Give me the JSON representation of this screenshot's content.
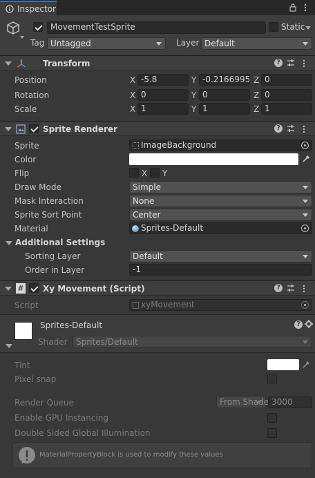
{
  "window": {
    "tab_label": "Inspector"
  },
  "gameobject": {
    "active": true,
    "name": "MovementTestSprite",
    "static_label": "Static",
    "tag_label": "Tag",
    "tag_value": "Untagged",
    "layer_label": "Layer",
    "layer_value": "Default"
  },
  "transform": {
    "title": "Transform",
    "position_label": "Position",
    "rotation_label": "Rotation",
    "scale_label": "Scale",
    "axis_x": "X",
    "axis_y": "Y",
    "axis_z": "Z",
    "position": {
      "x": "-5.8",
      "y": "-0.2166995",
      "z": "0"
    },
    "rotation": {
      "x": "0",
      "y": "0",
      "z": "0"
    },
    "scale": {
      "x": "1",
      "y": "1",
      "z": "1"
    }
  },
  "sprite_renderer": {
    "title": "Sprite Renderer",
    "enabled": true,
    "sprite_label": "Sprite",
    "sprite_value": "ImageBackground",
    "color_label": "Color",
    "color_value": "#ffffff",
    "flip_label": "Flip",
    "flip_x": "X",
    "flip_y": "Y",
    "draw_mode_label": "Draw Mode",
    "draw_mode_value": "Simple",
    "mask_label": "Mask Interaction",
    "mask_value": "None",
    "sort_point_label": "Sprite Sort Point",
    "sort_point_value": "Center",
    "material_label": "Material",
    "material_value": "Sprites-Default",
    "additional_label": "Additional Settings",
    "sorting_layer_label": "Sorting Layer",
    "sorting_layer_value": "Default",
    "order_label": "Order in Layer",
    "order_value": "-1"
  },
  "xy_movement": {
    "title": "Xy Movement (Script)",
    "enabled": true,
    "script_label": "Script",
    "script_value": "xyMovement"
  },
  "material": {
    "name": "Sprites-Default",
    "shader_label": "Shader",
    "shader_value": "Sprites/Default",
    "tint_label": "Tint",
    "tint_value": "#ffffff",
    "pixel_snap_label": "Pixel snap",
    "render_queue_label": "Render Queue",
    "render_queue_mode": "From Shader",
    "render_queue_value": "3000",
    "gpu_instancing_label": "Enable GPU Instancing",
    "double_sided_label": "Double Sided Global Illumination",
    "info_message": "MaterialPropertyBlock is used to modify these values"
  }
}
